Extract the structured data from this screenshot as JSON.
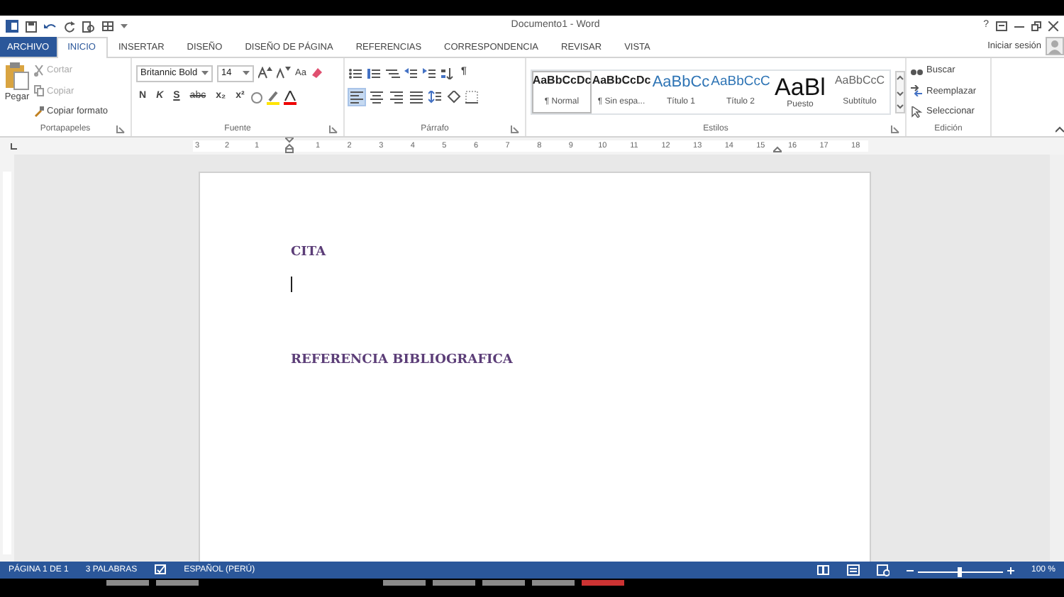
{
  "window": {
    "title": "Documento1 - Word",
    "help": "?",
    "sign_in": "Iniciar sesión"
  },
  "tabs": [
    {
      "label": "ARCHIVO",
      "kind": "file",
      "selected": false
    },
    {
      "label": "INICIO",
      "kind": "tab",
      "selected": true
    },
    {
      "label": "INSERTAR",
      "kind": "tab",
      "selected": false
    },
    {
      "label": "DISEÑO",
      "kind": "tab",
      "selected": false
    },
    {
      "label": "DISEÑO DE PÁGINA",
      "kind": "tab",
      "selected": false
    },
    {
      "label": "REFERENCIAS",
      "kind": "tab",
      "selected": false
    },
    {
      "label": "CORRESPONDENCIA",
      "kind": "tab",
      "selected": false
    },
    {
      "label": "REVISAR",
      "kind": "tab",
      "selected": false
    },
    {
      "label": "VISTA",
      "kind": "tab",
      "selected": false
    }
  ],
  "clipboard": {
    "paste": "Pegar",
    "label": "Portapapeles",
    "items": [
      {
        "label": "Cortar",
        "kind": "cut",
        "disabled": true
      },
      {
        "label": "Copiar",
        "kind": "copy",
        "disabled": true
      },
      {
        "label": "Copiar formato",
        "kind": "brush",
        "disabled": false
      }
    ]
  },
  "font": {
    "label": "Fuente",
    "name": "Britannic Bold",
    "size": "14",
    "change_case": "Aa",
    "format_buttons": [
      "N",
      "K",
      "S",
      "abc",
      "x₂",
      "x²"
    ]
  },
  "paragraph": {
    "label": "Párrafo",
    "show_marks": "¶",
    "alignments": [
      {
        "kind": "left",
        "selected": true
      },
      {
        "kind": "center",
        "selected": false
      },
      {
        "kind": "right",
        "selected": false
      },
      {
        "kind": "justify",
        "selected": false
      }
    ]
  },
  "styles": {
    "label": "Estilos",
    "items": [
      {
        "preview": "AaBbCcDc",
        "name": "¶ Normal",
        "kind": "body",
        "selected": true
      },
      {
        "preview": "AaBbCcDc",
        "name": "¶ Sin espa...",
        "kind": "body",
        "selected": false
      },
      {
        "preview": "AaBbCc",
        "name": "Título 1",
        "kind": "heading1",
        "selected": false
      },
      {
        "preview": "AaBbCcC",
        "name": "Título 2",
        "kind": "heading2",
        "selected": false
      },
      {
        "preview": "AaBl",
        "name": "Puesto",
        "kind": "title",
        "selected": false
      },
      {
        "preview": "AaBbCcC",
        "name": "Subtítulo",
        "kind": "subtitle",
        "selected": false
      }
    ]
  },
  "editing": {
    "label": "Edición",
    "items": [
      {
        "label": "Buscar",
        "kind": "find"
      },
      {
        "label": "Reemplazar",
        "kind": "replace"
      },
      {
        "label": "Seleccionar",
        "kind": "select"
      }
    ]
  },
  "ruler": {
    "left_ticks": [
      "3",
      "2",
      "1"
    ],
    "ticks": [
      "1",
      "2",
      "3",
      "4",
      "5",
      "6",
      "7",
      "8",
      "9",
      "10",
      "11",
      "12",
      "13",
      "14",
      "15",
      "16",
      "17",
      "18"
    ]
  },
  "document": {
    "paragraphs": [
      {
        "text": "CITA",
        "cursor_after": true
      },
      {
        "text": "REFERENCIA BIBLIOGRAFICA",
        "cursor_after": false
      }
    ]
  },
  "status_bar": {
    "page": "PÁGINA 1 DE 1",
    "words": "3 PALABRAS",
    "language": "ESPAÑOL (PERÚ)",
    "zoom": "100 %",
    "level": 0.5
  }
}
